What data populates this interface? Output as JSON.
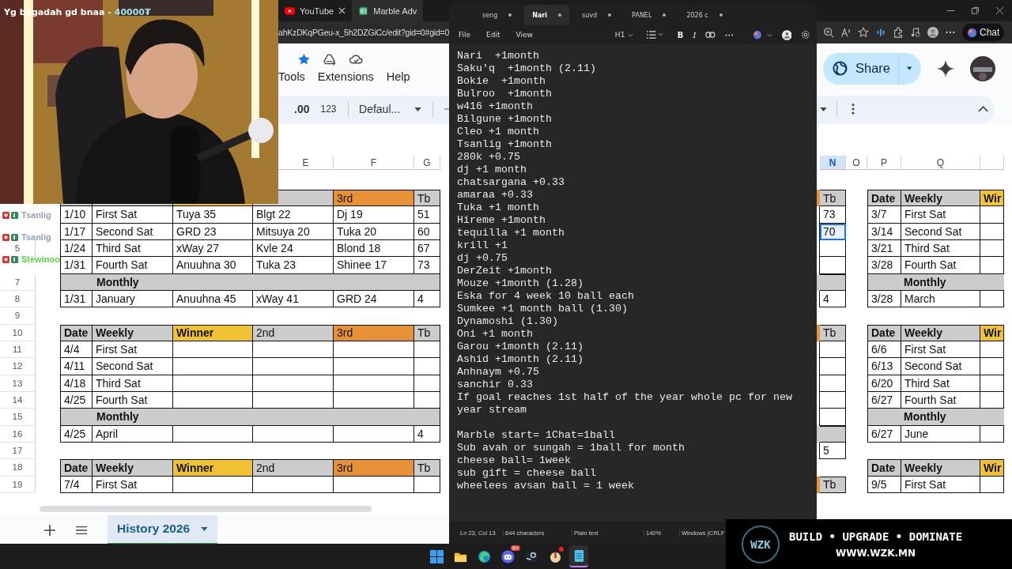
{
  "stream_overlay": {
    "donation": {
      "text": "Yg bagadah gd bnaa -",
      "amount": "40000₮"
    },
    "chat": [
      {
        "name": "Tsanlig",
        "color": "#8fa3b3"
      },
      {
        "name": "Tsanlig",
        "color": "#8fa3b3"
      },
      {
        "name": "Stewinoo",
        "color": "#5ccf4a"
      }
    ],
    "sponsor": {
      "logo": "WZK",
      "slogan": "BUILD • UPGRADE • DOMINATE",
      "url": "WWW.WZK.MN"
    }
  },
  "browser": {
    "tabs": [
      {
        "title": "YouTube",
        "selected": false
      },
      {
        "title": "Marble Adv",
        "selected": true
      }
    ],
    "address": "ahKzDKqPGeu-x_5h2DZGiCc/edit?gid=0#gid=0",
    "chat_button": "Chat"
  },
  "sheet": {
    "menu": [
      "Tools",
      "Extensions",
      "Help"
    ],
    "toolbar": {
      "decimals": ".00",
      "number_format": "123",
      "font": "Defaul..."
    },
    "share": "Share",
    "left": {
      "columns": [
        {
          "label": "E",
          "selected": false
        },
        {
          "label": "F",
          "selected": false
        },
        {
          "label": "G",
          "selected": false
        }
      ],
      "rows": [
        {
          "kind": "gap"
        },
        {
          "kind": "header",
          "cells": [
            null,
            null,
            null,
            null,
            "3rd",
            "Tb"
          ]
        },
        {
          "kind": "week",
          "cells": [
            "1/10",
            "First Sat",
            "Tuya 35",
            "Blgt 22",
            "Dj 19",
            "51"
          ]
        },
        {
          "kind": "week",
          "cells": [
            "1/17",
            "Second Sat",
            "GRD 23",
            "Mitsuya 20",
            "Tuka 20",
            "60"
          ]
        },
        {
          "num": "5",
          "kind": "week",
          "cells": [
            "1/24",
            "Third Sat",
            "xWay 27",
            "Kvle 24",
            "Blond 18",
            "67"
          ]
        },
        {
          "kind": "week",
          "cells": [
            "1/31",
            "Fourth Sat",
            "Anuuhna 30",
            "Tuka 23",
            "Shinee 17",
            "73"
          ]
        },
        {
          "num": "7",
          "kind": "monthly",
          "label": "Monthly"
        },
        {
          "num": "8",
          "kind": "week",
          "cells": [
            "1/31",
            "January",
            "Anuuhna 45",
            "xWay 41",
            "GRD 24",
            "4"
          ]
        },
        {
          "num": "9",
          "kind": "gap"
        },
        {
          "num": "10",
          "kind": "header",
          "cells": [
            "Date",
            "Weekly",
            "Winner",
            "2nd",
            "3rd",
            "Tb"
          ]
        },
        {
          "num": "11",
          "kind": "week",
          "cells": [
            "4/4",
            "First Sat",
            null,
            null,
            null,
            null
          ]
        },
        {
          "num": "12",
          "kind": "week",
          "cells": [
            "4/11",
            "Second Sat",
            null,
            null,
            null,
            null
          ]
        },
        {
          "num": "13",
          "kind": "week",
          "cells": [
            "4/18",
            "Third Sat",
            null,
            null,
            null,
            null
          ]
        },
        {
          "num": "14",
          "kind": "week",
          "cells": [
            "4/25",
            "Fourth Sat",
            null,
            null,
            null,
            null
          ]
        },
        {
          "num": "15",
          "kind": "monthly",
          "label": "Monthly"
        },
        {
          "num": "16",
          "kind": "week",
          "cells": [
            "4/25",
            "April",
            null,
            null,
            null,
            "4"
          ]
        },
        {
          "num": "17",
          "kind": "gap"
        },
        {
          "num": "18",
          "kind": "header",
          "cells": [
            "Date",
            "Weekly",
            "Winner",
            "2nd",
            "3rd",
            "Tb"
          ]
        },
        {
          "num": "19",
          "kind": "week",
          "cells": [
            "7/4",
            "First Sat",
            null,
            null,
            null,
            null
          ]
        }
      ]
    },
    "right": {
      "columns": [
        {
          "label": "N",
          "selected": true
        },
        {
          "label": "O",
          "selected": false
        },
        {
          "label": "P",
          "selected": false
        },
        {
          "label": "Q",
          "selected": false
        }
      ],
      "tb_column": [
        {
          "kind": "gap",
          "selected": false
        },
        {
          "kind": "header",
          "text": "Tb",
          "selected": false
        },
        {
          "kind": "value",
          "text": "73",
          "selected": false
        },
        {
          "kind": "value",
          "text": "70",
          "selected": true
        },
        {
          "kind": "empty",
          "selected": false
        },
        {
          "kind": "empty",
          "selected": false
        },
        {
          "kind": "band",
          "selected": false
        },
        {
          "kind": "value",
          "text": "4",
          "selected": false
        },
        {
          "kind": "gap",
          "selected": false
        },
        {
          "kind": "header",
          "text": "Tb",
          "selected": false
        },
        {
          "kind": "empty",
          "selected": false
        },
        {
          "kind": "empty",
          "selected": false
        },
        {
          "kind": "empty",
          "selected": false
        },
        {
          "kind": "empty",
          "selected": false
        },
        {
          "kind": "empty",
          "selected": false
        },
        {
          "kind": "band",
          "selected": false
        },
        {
          "kind": "value",
          "text": "5",
          "selected": false
        },
        {
          "kind": "gap",
          "selected": false
        },
        {
          "kind": "header",
          "text": "Tb",
          "selected": false
        }
      ],
      "rows": [
        {
          "kind": "gap"
        },
        {
          "kind": "header",
          "cells": [
            "Date",
            "Weekly",
            "Wir"
          ]
        },
        {
          "kind": "week",
          "cells": [
            "3/7",
            "First Sat",
            null
          ]
        },
        {
          "kind": "week",
          "cells": [
            "3/14",
            "Second Sat",
            null
          ]
        },
        {
          "kind": "week",
          "cells": [
            "3/21",
            "Third Sat",
            null
          ]
        },
        {
          "kind": "week",
          "cells": [
            "3/28",
            "Fourth Sat",
            null
          ]
        },
        {
          "kind": "monthly",
          "label": "Monthly"
        },
        {
          "kind": "week",
          "cells": [
            "3/28",
            "March",
            null
          ]
        },
        {
          "kind": "gap"
        },
        {
          "kind": "header",
          "cells": [
            "Date",
            "Weekly",
            "Wir"
          ]
        },
        {
          "kind": "week",
          "cells": [
            "6/6",
            "First Sat",
            null
          ]
        },
        {
          "kind": "week",
          "cells": [
            "6/13",
            "Second Sat",
            null
          ]
        },
        {
          "kind": "week",
          "cells": [
            "6/20",
            "Third Sat",
            null
          ]
        },
        {
          "kind": "week",
          "cells": [
            "6/27",
            "Fourth Sat",
            null
          ]
        },
        {
          "kind": "monthly",
          "label": "Monthly"
        },
        {
          "kind": "week",
          "cells": [
            "6/27",
            "June",
            null
          ]
        },
        {
          "kind": "gap"
        },
        {
          "kind": "header",
          "cells": [
            "Date",
            "Weekly",
            "Wir"
          ]
        },
        {
          "kind": "week",
          "cells": [
            "9/5",
            "First Sat",
            null
          ]
        }
      ]
    },
    "sheet_tabs": [
      {
        "label": "History 2026",
        "selected": true
      }
    ]
  },
  "notepad": {
    "tabs": [
      {
        "title": "seng",
        "selected": false
      },
      {
        "title": "Nari",
        "selected": true
      },
      {
        "title": "suvd",
        "selected": false
      },
      {
        "title": "PANEL",
        "selected": false
      },
      {
        "title": "2026 c",
        "selected": false
      }
    ],
    "menu": [
      "File",
      "Edit",
      "View"
    ],
    "format": {
      "heading": "H1",
      "bold": "B",
      "italic": "I"
    },
    "blocks": [
      [
        "Nari  +1month",
        "Saku'q  +1month (2.11)",
        "Bokie  +1month",
        "Bulroo  +1month",
        "w416 +1month",
        "Bilgune +1month",
        "Cleo +1 month",
        "Tsanlig +1month",
        "280k +0.75",
        "dj +1 month",
        "chatsargana +0.33",
        "amaraa +0.33",
        "Tuka +1 month",
        "Hireme +1month",
        "tequilla +1 month",
        "krill +1",
        "dj +0.75",
        "DerZeit +1month",
        "Mouze +1month (1.28)",
        "Eska for 4 week 10 ball each",
        "Sumkee +1 month ball (1.30)",
        "Dynamoshi (1.30)",
        "Oni +1 month",
        "Garou +1month (2.11)",
        "Ashid +1month (2.11)",
        "Anhnaym +0.75",
        "sanchir 0.33",
        "If goal reaches 1st half of the year whole pc for new year stream"
      ],
      [
        "Marble start= 1Chat=1ball",
        "Sub avah or sungah = 1ball for month",
        "cheese ball= 1week",
        "sub gift = cheese ball",
        "wheelees avsan ball = 1 week"
      ]
    ],
    "status": [
      "Ln 23, Col 13",
      "644 characters",
      "Plain text",
      "140%",
      "Windows (CRLF"
    ]
  },
  "taskbar": {
    "apps": [
      {
        "kind": "windows",
        "active": false,
        "notification": false
      },
      {
        "kind": "folder",
        "active": false,
        "notification": false
      },
      {
        "kind": "edge",
        "active": false,
        "notification": false
      },
      {
        "kind": "discord",
        "active": false,
        "notification": false,
        "badge": "9+"
      },
      {
        "kind": "steam",
        "active": false,
        "notification": false
      },
      {
        "kind": "app",
        "active": false,
        "notification": true
      },
      {
        "kind": "notepad",
        "active": true,
        "notification": false
      }
    ]
  }
}
